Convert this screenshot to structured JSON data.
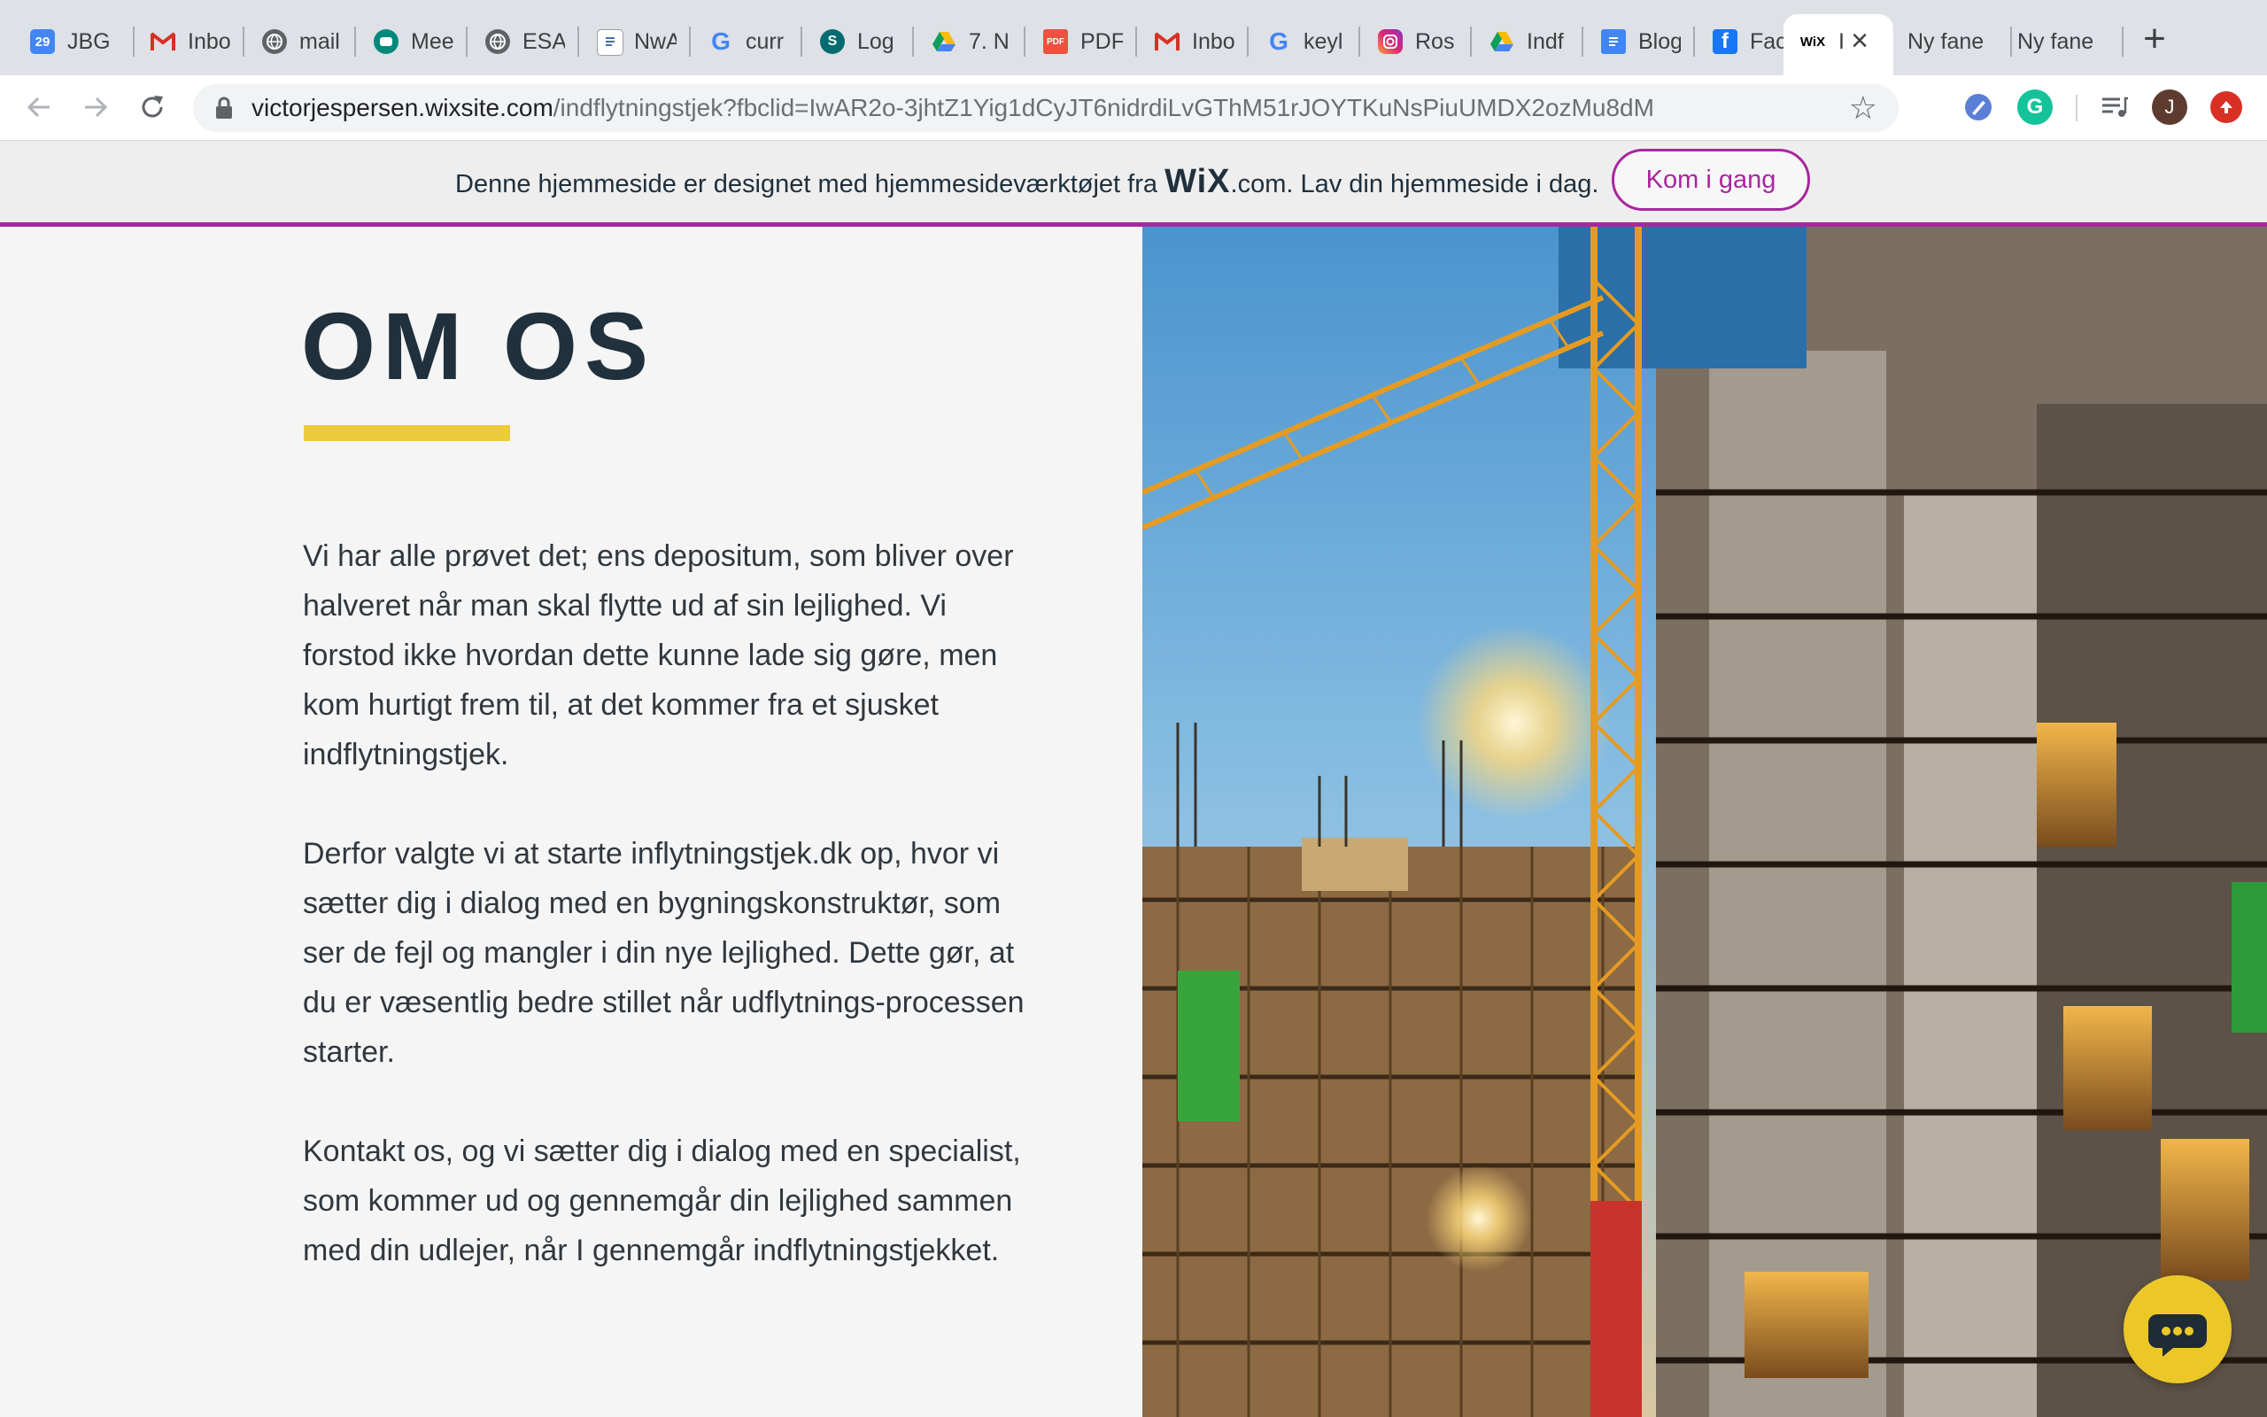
{
  "browser": {
    "tabs": [
      {
        "label": "JBG",
        "icon": "calendar-icon"
      },
      {
        "label": "Inbo",
        "icon": "gmail-icon"
      },
      {
        "label": "mail",
        "icon": "globe-icon"
      },
      {
        "label": "Mee",
        "icon": "meet-icon"
      },
      {
        "label": "ESA",
        "icon": "globe-icon"
      },
      {
        "label": "NwA",
        "icon": "document-icon"
      },
      {
        "label": "curr",
        "icon": "google-icon"
      },
      {
        "label": "Log",
        "icon": "sharepoint-icon"
      },
      {
        "label": "7. N",
        "icon": "drive-icon"
      },
      {
        "label": "PDF",
        "icon": "pdf-icon"
      },
      {
        "label": "Inbo",
        "icon": "gmail-icon"
      },
      {
        "label": "keyl",
        "icon": "google-icon"
      },
      {
        "label": "Ros",
        "icon": "instagram-icon"
      },
      {
        "label": "Indf",
        "icon": "drive-icon"
      },
      {
        "label": "Blog",
        "icon": "docs-icon"
      },
      {
        "label": "Face",
        "icon": "facebook-icon"
      },
      {
        "label": "I",
        "icon": "wix-icon",
        "favicon_text": "WiX",
        "active": true
      },
      {
        "label": "Ny fane",
        "icon": ""
      },
      {
        "label": "Ny fane",
        "icon": ""
      }
    ],
    "calendar_day": "29",
    "pdf_badge": "PDF",
    "url": {
      "host": "victorjespersen.wixsite.com",
      "path": "/indflytningstjek?fbclid=IwAR2o-3jhtZ1Yig1dCyJT6nidrdiLvGThM51rJOYTKuNsPiuUMDX2ozMu8dM"
    },
    "profile_initial": "J",
    "colors": {
      "tab_strip": "#dee1e6",
      "toolbar": "#ffffff",
      "omnibox": "#f1f3f4"
    }
  },
  "wix_banner": {
    "text_before": "Denne hjemmeside er designet med hjemmesideværktøjet fra ",
    "logo": "WiX",
    "text_after": ".com. Lav din hjemmeside i dag.",
    "button_label": "Kom i gang",
    "accent_color": "#a8269e"
  },
  "page": {
    "heading": "OM OS",
    "accent_color": "#ebcb3c",
    "paragraphs": [
      "Vi har alle prøvet det; ens depositum, som bliver over halveret når man skal flytte ud af sin lejlighed. Vi forstod ikke hvordan dette kunne lade sig gøre, men kom hurtigt frem til, at det kommer fra et sjusket indflytningstjek.",
      "Derfor valgte vi at starte inflytningstjek.dk op, hvor vi sætter dig i dialog med en bygningskonstruktør, som ser de fejl og mangler i din nye lejlighed. Dette gør, at du er væsentlig bedre stillet når udflytnings-processen starter.",
      "Kontakt os, og vi sætter dig i dialog med en specialist, som kommer ud og gennemgår din lejlighed sammen med din udlejer, når I gennemgår indflytningstjekket."
    ],
    "chat_color": "#ebc828"
  }
}
